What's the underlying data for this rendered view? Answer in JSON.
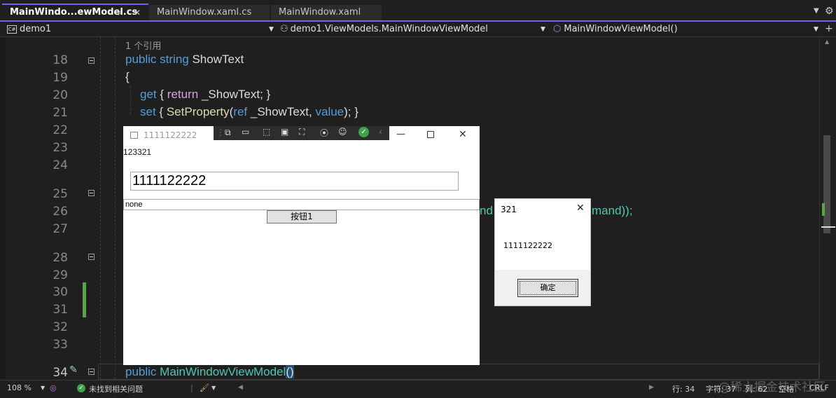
{
  "tabs": [
    {
      "label": "MainWindo...ewModel.cs",
      "active": true
    },
    {
      "label": "MainWindow.xaml.cs"
    },
    {
      "label": "MainWindow.xaml"
    }
  ],
  "nav": {
    "project": "demo1",
    "class": "demo1.ViewModels.MainWindowViewModel",
    "member": "MainWindowViewModel()"
  },
  "editor": {
    "reference_hint": "1 个引用",
    "line_numbers": [
      "18",
      "19",
      "20",
      "21",
      "22",
      "23",
      "24",
      "25",
      "26",
      "27",
      "28",
      "29",
      "30",
      "31",
      "32",
      "33",
      "34"
    ],
    "code": {
      "l18_kw": "public",
      "l18_type": "string",
      "l18_name": "ShowText",
      "l19": "{",
      "l20_a": "get",
      "l20_b": "{",
      "l20_c": "return",
      "l20_d": "_ShowText; }",
      "l21_a": "set",
      "l21_b": "{",
      "l21_c": "SetProperty",
      "l21_d": "(",
      "l21_e": "ref",
      "l21_f": "_ShowText,",
      "l21_g": "value",
      "l21_h": "); }",
      "l26_left": "nd",
      "l26_right": "mand));",
      "l34_kw": "public",
      "l34_name": "MainWindowViewModel",
      "l34_paren": "()"
    }
  },
  "wpf_window": {
    "title": "1111122222",
    "label_top": "123321",
    "textbox_value": "1111122222",
    "combo_value": "none",
    "button_label": "按钮1"
  },
  "message_box": {
    "title": "321",
    "message": "1111122222",
    "ok_label": "确定"
  },
  "status": {
    "zoom": "108 %",
    "issues": "未找到相关问题",
    "line": "行: 34",
    "char": "字符: 37",
    "col": "列: 62",
    "mode": "空格",
    "eol": "CRLF"
  },
  "watermark": "@稀土掘金技术社区",
  "colors": {
    "accent": "#7160e8",
    "keyword": "#569cd6",
    "control": "#d8a0df",
    "type": "#4ec9b0",
    "method": "#dcdcaa",
    "change_bar": "#57a64a"
  }
}
